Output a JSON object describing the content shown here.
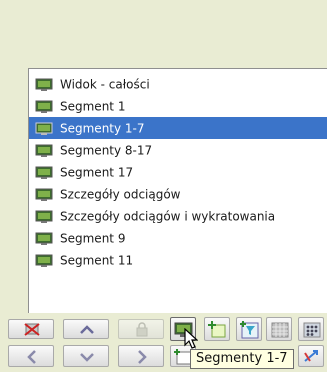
{
  "list": {
    "items": [
      {
        "label": "Widok - całości",
        "icon": "monitor-icon",
        "selected": false
      },
      {
        "label": "Segment 1",
        "icon": "monitor-icon",
        "selected": false
      },
      {
        "label": "Segmenty 1-7",
        "icon": "monitor-icon",
        "selected": true
      },
      {
        "label": "Segmenty 8-17",
        "icon": "monitor-icon",
        "selected": false
      },
      {
        "label": "Segment 17",
        "icon": "monitor-icon",
        "selected": false
      },
      {
        "label": "Szczegóły odciągów",
        "icon": "monitor-icon",
        "selected": false
      },
      {
        "label": "Szczegóły odciągów i wykratowania",
        "icon": "monitor-icon",
        "selected": false
      },
      {
        "label": "Segment 9",
        "icon": "monitor-icon",
        "selected": false
      },
      {
        "label": "Segment 11",
        "icon": "monitor-icon",
        "selected": false
      }
    ]
  },
  "toolbar": {
    "tooltip": "Segmenty 1-7",
    "buttons_row1": [
      "delete-view-icon",
      "move-up-icon",
      "lock-icon",
      "view-monitor-icon",
      "add-view-icon",
      "add-filter-view-icon",
      "grid-icon",
      "grid-dots-icon"
    ],
    "buttons_row2": [
      "previous-icon",
      "move-down-icon",
      "next-icon",
      "new-view-icon",
      "arrow-swap-icon"
    ]
  },
  "colors": {
    "background": "#e9ecd3",
    "selection": "#3b74c9",
    "tooltip_bg": "#ffffe1"
  }
}
